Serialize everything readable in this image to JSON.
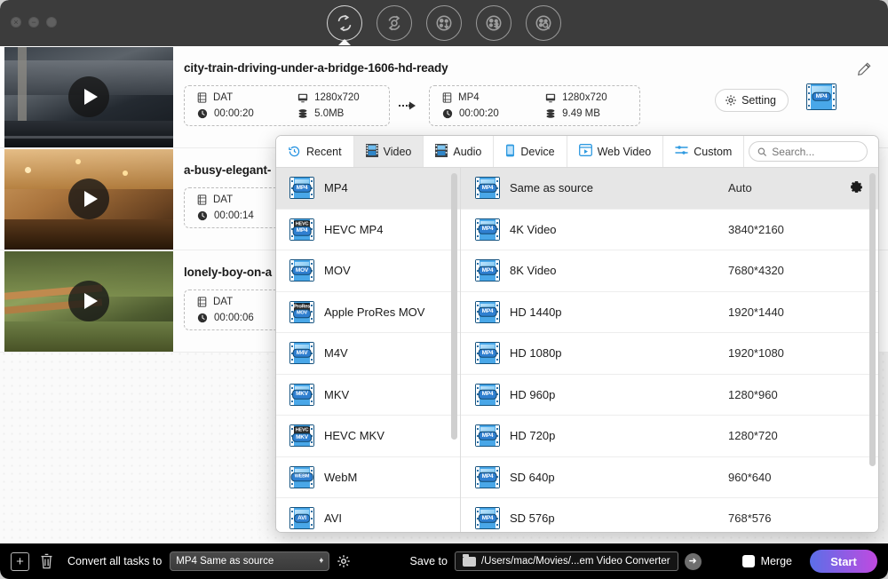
{
  "window": {
    "traffic_lights": [
      "close",
      "minimize",
      "maximize"
    ]
  },
  "toolbar": {
    "items": [
      {
        "icon": "convert-icon",
        "name": "Converter",
        "active": true
      },
      {
        "icon": "ripper-icon",
        "name": "Ripper",
        "active": false
      },
      {
        "icon": "downloader-icon",
        "name": "Downloader",
        "active": false
      },
      {
        "icon": "toolbox-icon",
        "name": "Toolbox",
        "active": false
      },
      {
        "icon": "recorder-icon",
        "name": "Recorder",
        "active": false
      }
    ]
  },
  "files": [
    {
      "name": "city-train-driving-under-a-bridge-1606-hd-ready",
      "source": {
        "format": "DAT",
        "resolution": "1280x720",
        "duration": "00:00:20",
        "size": "5.0MB"
      },
      "output": {
        "format": "MP4",
        "resolution": "1280x720",
        "duration": "00:00:20",
        "size": "9.49 MB"
      },
      "setting_label": "Setting",
      "badge": "MP4",
      "thumb_colors": [
        "#2b3138",
        "#4a5056",
        "#1b1f24"
      ]
    },
    {
      "name": "a-busy-elegant-",
      "source": {
        "format": "DAT",
        "duration": "00:00:14"
      },
      "thumb_colors": [
        "#8a5a2e",
        "#d8a05c",
        "#3a2413"
      ]
    },
    {
      "name": "lonely-boy-on-a",
      "source": {
        "format": "DAT",
        "duration": "00:00:06"
      },
      "thumb_colors": [
        "#55672f",
        "#b6854a",
        "#2e3a22"
      ]
    }
  ],
  "format_popup": {
    "tabs": [
      {
        "label": "Recent",
        "icon": "history-icon",
        "active": false
      },
      {
        "label": "Video",
        "icon": "video-icon",
        "active": true
      },
      {
        "label": "Audio",
        "icon": "audio-icon",
        "active": false
      },
      {
        "label": "Device",
        "icon": "device-icon",
        "active": false
      },
      {
        "label": "Web Video",
        "icon": "web-video-icon",
        "active": false
      },
      {
        "label": "Custom",
        "icon": "sliders-icon",
        "active": false
      }
    ],
    "search": {
      "placeholder": "Search...",
      "value": ""
    },
    "formats": [
      {
        "label": "MP4",
        "badge": "MP4",
        "selected": true
      },
      {
        "label": "HEVC MP4",
        "badge": "MP4",
        "top_badge": "HEVC",
        "selected": false
      },
      {
        "label": "MOV",
        "badge": "MOV",
        "selected": false
      },
      {
        "label": "Apple ProRes MOV",
        "badge": "MOV",
        "top_badge": "ProRes",
        "selected": false
      },
      {
        "label": "M4V",
        "badge": "M4V",
        "selected": false
      },
      {
        "label": "MKV",
        "badge": "MKV",
        "selected": false
      },
      {
        "label": "HEVC MKV",
        "badge": "MKV",
        "top_badge": "HEVC",
        "selected": false
      },
      {
        "label": "WebM",
        "badge": "WEBM",
        "selected": false
      },
      {
        "label": "AVI",
        "badge": "AVI",
        "selected": false
      }
    ],
    "resolutions": [
      {
        "label": "Same as source",
        "value": "Auto",
        "badge": "MP4",
        "selected": true,
        "gear": true
      },
      {
        "label": "4K Video",
        "value": "3840*2160",
        "badge": "MP4",
        "selected": false
      },
      {
        "label": "8K Video",
        "value": "7680*4320",
        "badge": "MP4",
        "selected": false
      },
      {
        "label": "HD 1440p",
        "value": "1920*1440",
        "badge": "MP4",
        "selected": false
      },
      {
        "label": "HD 1080p",
        "value": "1920*1080",
        "badge": "MP4",
        "selected": false
      },
      {
        "label": "HD 960p",
        "value": "1280*960",
        "badge": "MP4",
        "selected": false
      },
      {
        "label": "HD 720p",
        "value": "1280*720",
        "badge": "MP4",
        "selected": false
      },
      {
        "label": "SD 640p",
        "value": "960*640",
        "badge": "MP4",
        "selected": false
      },
      {
        "label": "SD 576p",
        "value": "768*576",
        "badge": "MP4",
        "selected": false
      }
    ]
  },
  "bottom_bar": {
    "add_icon": "add-file-icon",
    "delete_icon": "trash-icon",
    "convert_label": "Convert all tasks to",
    "convert_value": "MP4 Same as source",
    "gear_icon": "gear-icon",
    "save_label": "Save to",
    "save_path": "/Users/mac/Movies/...em Video Converter",
    "merge_label": "Merge",
    "merge_checked": false,
    "start_label": "Start"
  },
  "colors": {
    "accent_blue": "#5b6fe8",
    "accent_purple": "#c04ae0",
    "titlebar": "#3c3c3c",
    "bottombar": "#000000",
    "icon_blue": "#49a7e8"
  }
}
